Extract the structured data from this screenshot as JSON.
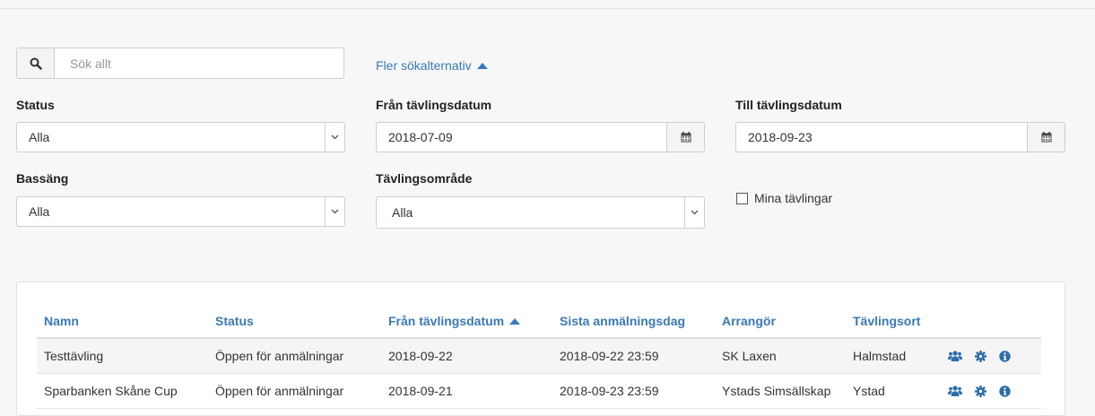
{
  "search": {
    "placeholder": "Sök allt",
    "more_label": "Fler sökalternativ"
  },
  "filters": {
    "status": {
      "label": "Status",
      "value": "Alla"
    },
    "from_date": {
      "label": "Från tävlingsdatum",
      "value": "2018-07-09"
    },
    "to_date": {
      "label": "Till tävlingsdatum",
      "value": "2018-09-23"
    },
    "pool": {
      "label": "Bassäng",
      "value": "Alla"
    },
    "area": {
      "label": "Tävlingsområde",
      "value": "Alla"
    },
    "mine": {
      "label": "Mina tävlingar",
      "checked": false
    }
  },
  "table": {
    "headers": {
      "name": "Namn",
      "status": "Status",
      "from": "Från tävlingsdatum",
      "deadline": "Sista anmälningsdag",
      "organizer": "Arrangör",
      "city": "Tävlingsort"
    },
    "rows": [
      {
        "name": "Testtävling",
        "status": "Öppen för anmälningar",
        "from": "2018-09-22",
        "deadline": "2018-09-22 23:59",
        "organizer": "SK Laxen",
        "city": "Halmstad"
      },
      {
        "name": "Sparbanken Skåne Cup",
        "status": "Öppen för anmälningar",
        "from": "2018-09-21",
        "deadline": "2018-09-23 23:59",
        "organizer": "Ystads Simsällskap",
        "city": "Ystad"
      }
    ]
  },
  "colors": {
    "link": "#3a79b6",
    "icon": "#2d6ca8"
  },
  "icons": {
    "search": "search-icon",
    "calendar": "calendar-icon",
    "participants": "users-icon",
    "settings": "gear-icon",
    "info": "info-icon"
  }
}
